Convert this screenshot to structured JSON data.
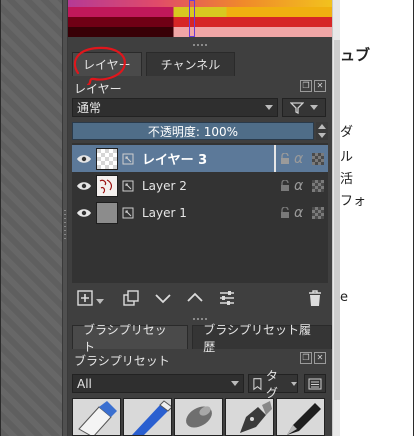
{
  "layers_panel": {
    "tab_layers": "レイヤー",
    "tab_channels": "チャンネル",
    "title": "レイヤー",
    "blend_mode": "通常",
    "opacity_label": "不透明度: 100%",
    "layers": [
      {
        "name": "レイヤー 3",
        "selected": true
      },
      {
        "name": "Layer 2",
        "selected": false
      },
      {
        "name": "Layer 1",
        "selected": false
      }
    ],
    "alpha_glyph": "α"
  },
  "brush_presets": {
    "tab_presets": "ブラシプリセット",
    "tab_history": "ブラシプリセット履歴",
    "title": "ブラシプリセット",
    "filter_value": "All",
    "tag_label": "タグ"
  },
  "document": {
    "lines": [
      "ュブ",
      "ダ",
      "ル",
      "活",
      "フォ",
      "e"
    ]
  },
  "colors": {
    "panel_bg": "#3f3f3f",
    "selected_row": "#5c7999",
    "opacity_bar": "#4f6d88",
    "annotation_red": "#e0161c"
  }
}
